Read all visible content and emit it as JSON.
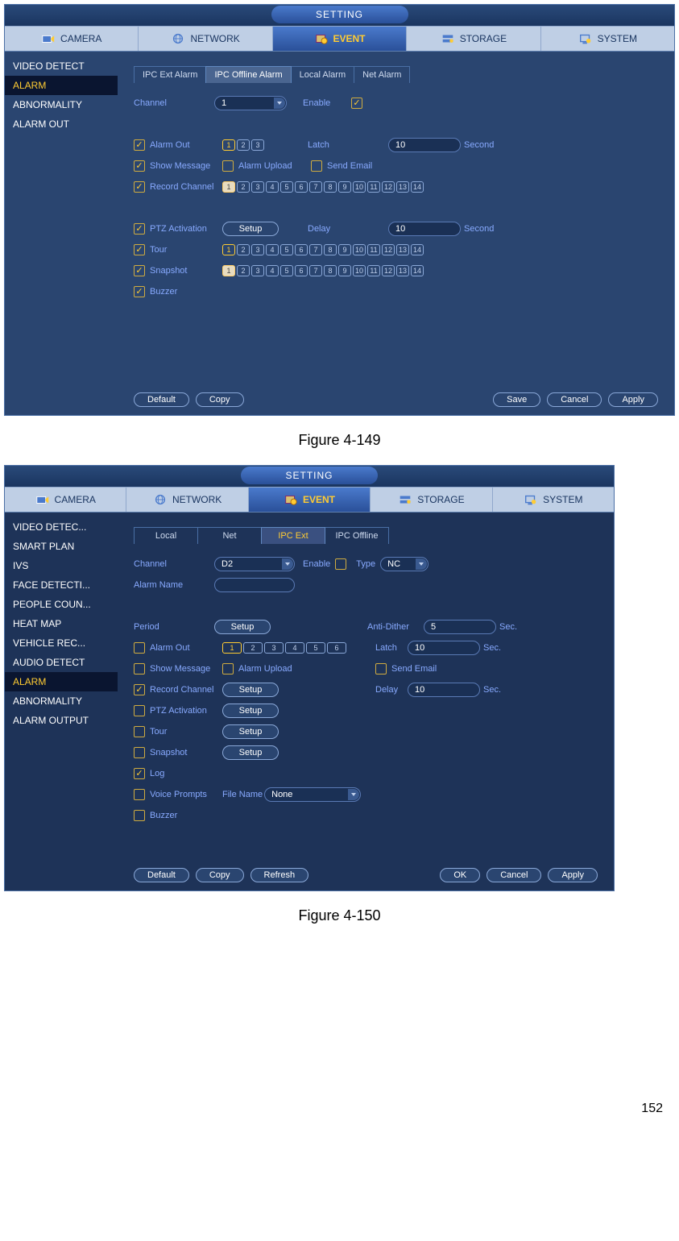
{
  "captions": {
    "fig149": "Figure 4-149",
    "fig150": "Figure 4-150"
  },
  "page_number": "152",
  "window1": {
    "title": "SETTING",
    "tabs": [
      "CAMERA",
      "NETWORK",
      "EVENT",
      "STORAGE",
      "SYSTEM"
    ],
    "active_tab": "EVENT",
    "sidebar": [
      "VIDEO DETECT",
      "ALARM",
      "ABNORMALITY",
      "ALARM OUT"
    ],
    "active_sidebar": "ALARM",
    "subtabs": [
      "IPC Ext Alarm",
      "IPC Offline Alarm",
      "Local Alarm",
      "Net Alarm"
    ],
    "active_subtab": "IPC Offline Alarm",
    "labels": {
      "channel": "Channel",
      "enable": "Enable",
      "alarm_out": "Alarm Out",
      "latch": "Latch",
      "second": "Second",
      "show_message": "Show Message",
      "alarm_upload": "Alarm Upload",
      "send_email": "Send Email",
      "record_channel": "Record Channel",
      "ptz": "PTZ Activation",
      "setup": "Setup",
      "delay": "Delay",
      "tour": "Tour",
      "snapshot": "Snapshot",
      "buzzer": "Buzzer"
    },
    "values": {
      "channel": "1",
      "latch": "10",
      "delay": "10",
      "alarm_out": [
        1,
        2,
        3
      ],
      "alarm_out_sel": [
        1
      ],
      "rec_channels": 14,
      "rec_sel": [
        1
      ],
      "tour_channels": 14,
      "tour_sel": [
        1
      ],
      "snap_channels": 14,
      "snap_sel": [
        1
      ]
    },
    "checks": {
      "enable": true,
      "alarm_out": true,
      "show_message": true,
      "alarm_upload": false,
      "send_email": false,
      "record_channel": true,
      "ptz": true,
      "tour": true,
      "snapshot": true,
      "buzzer": true
    },
    "buttons": {
      "default": "Default",
      "copy": "Copy",
      "save": "Save",
      "cancel": "Cancel",
      "apply": "Apply"
    }
  },
  "window2": {
    "title": "SETTING",
    "tabs": [
      "CAMERA",
      "NETWORK",
      "EVENT",
      "STORAGE",
      "SYSTEM"
    ],
    "active_tab": "EVENT",
    "sidebar": [
      "VIDEO DETEC...",
      "SMART PLAN",
      "IVS",
      "FACE DETECTI...",
      "PEOPLE COUN...",
      "HEAT MAP",
      "VEHICLE REC...",
      "AUDIO DETECT",
      "ALARM",
      "ABNORMALITY",
      "ALARM OUTPUT"
    ],
    "active_sidebar": "ALARM",
    "subtabs": [
      "Local",
      "Net",
      "IPC Ext",
      "IPC Offline"
    ],
    "active_subtab": "IPC Ext",
    "labels": {
      "channel": "Channel",
      "enable": "Enable",
      "type": "Type",
      "alarm_name": "Alarm Name",
      "period": "Period",
      "setup": "Setup",
      "anti_dither": "Anti-Dither",
      "sec": "Sec.",
      "alarm_out": "Alarm Out",
      "latch": "Latch",
      "show_message": "Show Message",
      "alarm_upload": "Alarm Upload",
      "send_email": "Send Email",
      "record_channel": "Record Channel",
      "delay": "Delay",
      "ptz": "PTZ Activation",
      "tour": "Tour",
      "snapshot": "Snapshot",
      "log": "Log",
      "voice_prompts": "Voice Prompts",
      "file_name": "File Name",
      "buzzer": "Buzzer"
    },
    "values": {
      "channel": "D2",
      "type": "NC",
      "alarm_name": "",
      "anti_dither": "5",
      "latch": "10",
      "delay": "10",
      "file_name": "None",
      "alarm_out": [
        1,
        2,
        3,
        4,
        5,
        6
      ],
      "alarm_out_sel": [
        1
      ]
    },
    "checks": {
      "enable": false,
      "alarm_out": false,
      "show_message": false,
      "alarm_upload": false,
      "send_email": false,
      "record_channel": true,
      "ptz": false,
      "tour": false,
      "snapshot": false,
      "log": true,
      "voice_prompts": false,
      "buzzer": false
    },
    "buttons": {
      "default": "Default",
      "copy": "Copy",
      "refresh": "Refresh",
      "ok": "OK",
      "cancel": "Cancel",
      "apply": "Apply"
    }
  }
}
